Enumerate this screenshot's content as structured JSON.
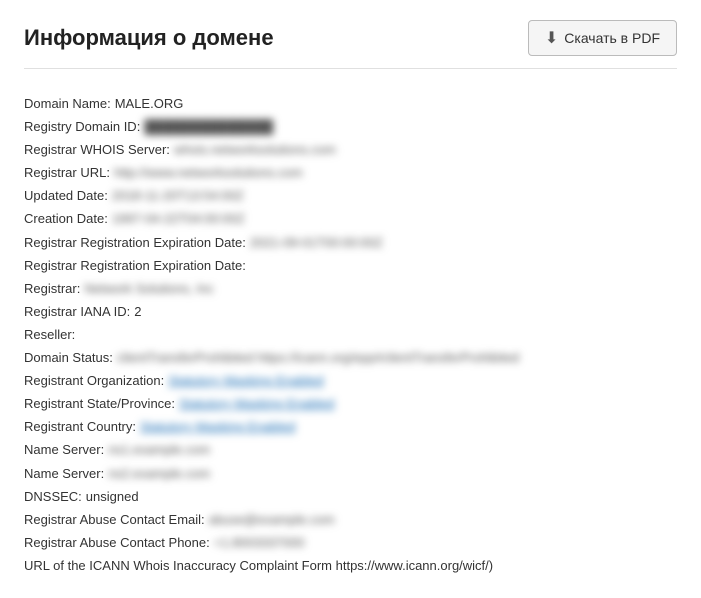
{
  "header": {
    "title": "Информация о домене",
    "pdf_button_label": "Скачать в PDF"
  },
  "whois": {
    "rows": [
      {
        "label": "Domain Name:",
        "value": "  MALE.ORG",
        "type": "plain"
      },
      {
        "label": "Registry Domain ID:",
        "value": "██████████████",
        "type": "blurred"
      },
      {
        "label": "Registrar WHOIS Server:",
        "value": "whois.networksolutions.com",
        "type": "blurred"
      },
      {
        "label": "Registrar URL:",
        "value": "http://www.networksolutions.com",
        "type": "blurred"
      },
      {
        "label": "Updated Date:",
        "value": "2018-11-20T13:54:00Z",
        "type": "blurred"
      },
      {
        "label": "Creation Date:",
        "value": "1997-04-22T04:00:00Z",
        "type": "blurred"
      },
      {
        "label": "Registrar Registration Expiration Date:",
        "value": "2021-09-01T00:00:00Z",
        "type": "blurred"
      },
      {
        "label": "Registrar Registration Expiration Date:",
        "value": "",
        "type": "plain"
      },
      {
        "label": "Registrar:",
        "value": "Network Solutions, Inc",
        "type": "blurred"
      },
      {
        "label": "Registrar IANA ID:",
        "value": "2",
        "type": "plain"
      },
      {
        "label": "Reseller:",
        "value": "",
        "type": "plain"
      },
      {
        "label": "Domain Status:",
        "value": "clientTransferProhibited https://icann.org/epp#clientTransferProhibited",
        "type": "blurred"
      },
      {
        "label": "Registrant Organization:",
        "value": "Statutory Masking Enabled",
        "type": "link-blurred"
      },
      {
        "label": "Registrant State/Province:",
        "value": "Statutory Masking Enabled",
        "type": "link-blurred"
      },
      {
        "label": "Registrant Country:",
        "value": "Statutory Masking Enabled",
        "type": "link-blurred"
      },
      {
        "label": "Name Server:",
        "value": "ns1.example.com",
        "type": "blurred"
      },
      {
        "label": "Name Server:",
        "value": "ns2.example.com",
        "type": "blurred"
      },
      {
        "label": "DNSSEC:",
        "value": "unsigned",
        "type": "plain"
      },
      {
        "label": "Registrar Abuse Contact Email:",
        "value": "abuse@example.com",
        "type": "blurred"
      },
      {
        "label": "Registrar Abuse Contact Phone:",
        "value": "+1.8003337000",
        "type": "blurred"
      },
      {
        "label": "URL of the ICANN Whois Inaccuracy Complaint Form https://www.icann.org/wicf/)",
        "value": "",
        "type": "plain"
      }
    ]
  }
}
